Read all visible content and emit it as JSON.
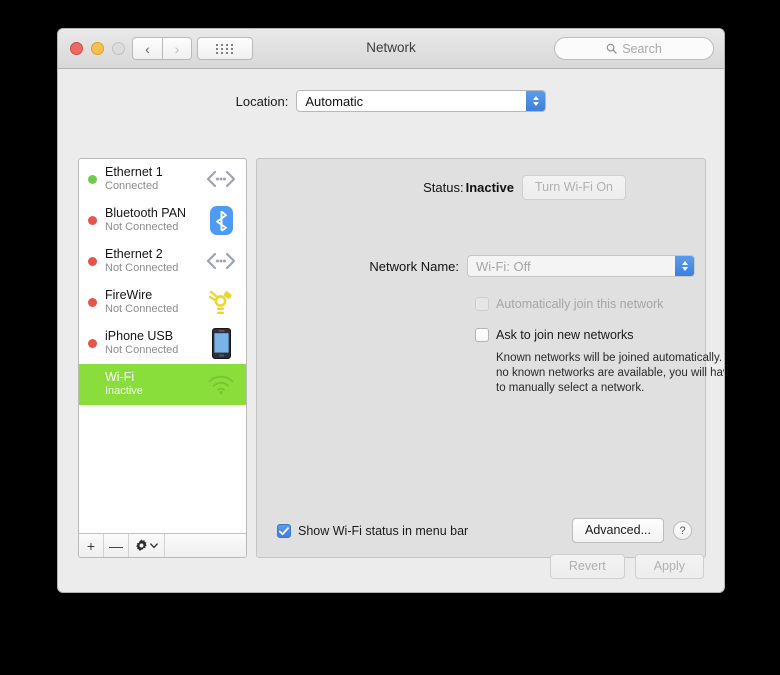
{
  "window": {
    "title": "Network",
    "traffic_lights": [
      "close",
      "minimize",
      "zoom"
    ],
    "nav_back": "‹",
    "nav_forward": "›",
    "grid_button": "show-all-icon",
    "search_placeholder": "Search"
  },
  "location": {
    "label": "Location:",
    "value": "Automatic"
  },
  "sidebar": {
    "services": [
      {
        "name": "Ethernet 1",
        "status": "Connected",
        "dot": "green",
        "icon": "ethernet-icon"
      },
      {
        "name": "Bluetooth PAN",
        "status": "Not Connected",
        "dot": "red",
        "icon": "bluetooth-icon"
      },
      {
        "name": "Ethernet 2",
        "status": "Not Connected",
        "dot": "red",
        "icon": "ethernet-icon"
      },
      {
        "name": "FireWire",
        "status": "Not Connected",
        "dot": "red",
        "icon": "firewire-icon"
      },
      {
        "name": "iPhone USB",
        "status": "Not Connected",
        "dot": "red",
        "icon": "iphone-icon"
      },
      {
        "name": "Wi-Fi",
        "status": "Inactive",
        "dot": "none",
        "icon": "wifi-icon",
        "selected": true
      }
    ],
    "toolbar": {
      "add": "+",
      "remove": "—",
      "actions": "gear-icon"
    }
  },
  "main": {
    "status_label": "Status:",
    "status_value": "Inactive",
    "turn_on_button": "Turn Wi-Fi On",
    "turn_on_disabled": true,
    "network_name_label": "Network Name:",
    "network_name_value": "Wi-Fi: Off",
    "network_name_disabled": true,
    "auto_join_label": "Automatically join this network",
    "auto_join_checked": false,
    "auto_join_disabled": true,
    "ask_join_label": "Ask to join new networks",
    "ask_join_checked": false,
    "help_text": "Known networks will be joined automatically. If no known networks are available, you will have to manually select a network.",
    "show_status_label": "Show Wi-Fi status in menu bar",
    "show_status_checked": true,
    "advanced_button": "Advanced...",
    "help_button": "?"
  },
  "footer": {
    "revert": "Revert",
    "apply": "Apply",
    "revert_disabled": true,
    "apply_disabled": true
  },
  "colors": {
    "selection_green": "#8ade3c",
    "window_bg": "#ececec",
    "panel_bg": "#e0e0e0",
    "accent_blue": "#3c7fdd",
    "dot_connected": "#6ccc48",
    "dot_disconnected": "#e8544a"
  }
}
